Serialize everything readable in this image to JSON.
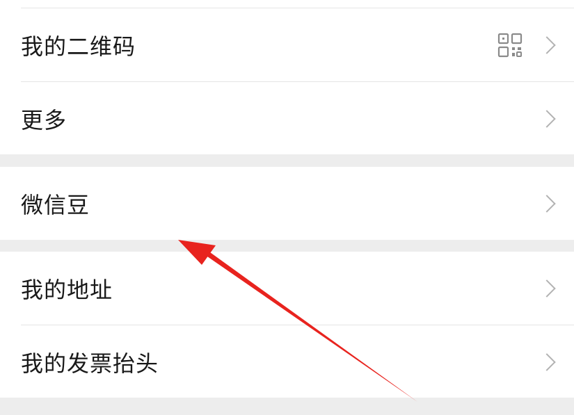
{
  "menu": {
    "group1": [
      {
        "label": "我的二维码",
        "icon": "qr-code-icon"
      },
      {
        "label": "更多"
      }
    ],
    "group2": [
      {
        "label": "微信豆"
      }
    ],
    "group3": [
      {
        "label": "我的地址"
      },
      {
        "label": "我的发票抬头"
      }
    ]
  },
  "colors": {
    "background": "#ededed",
    "card": "#ffffff",
    "text": "#191919",
    "chevron": "#b2b2b2",
    "annotation_arrow": "#e8231e"
  }
}
